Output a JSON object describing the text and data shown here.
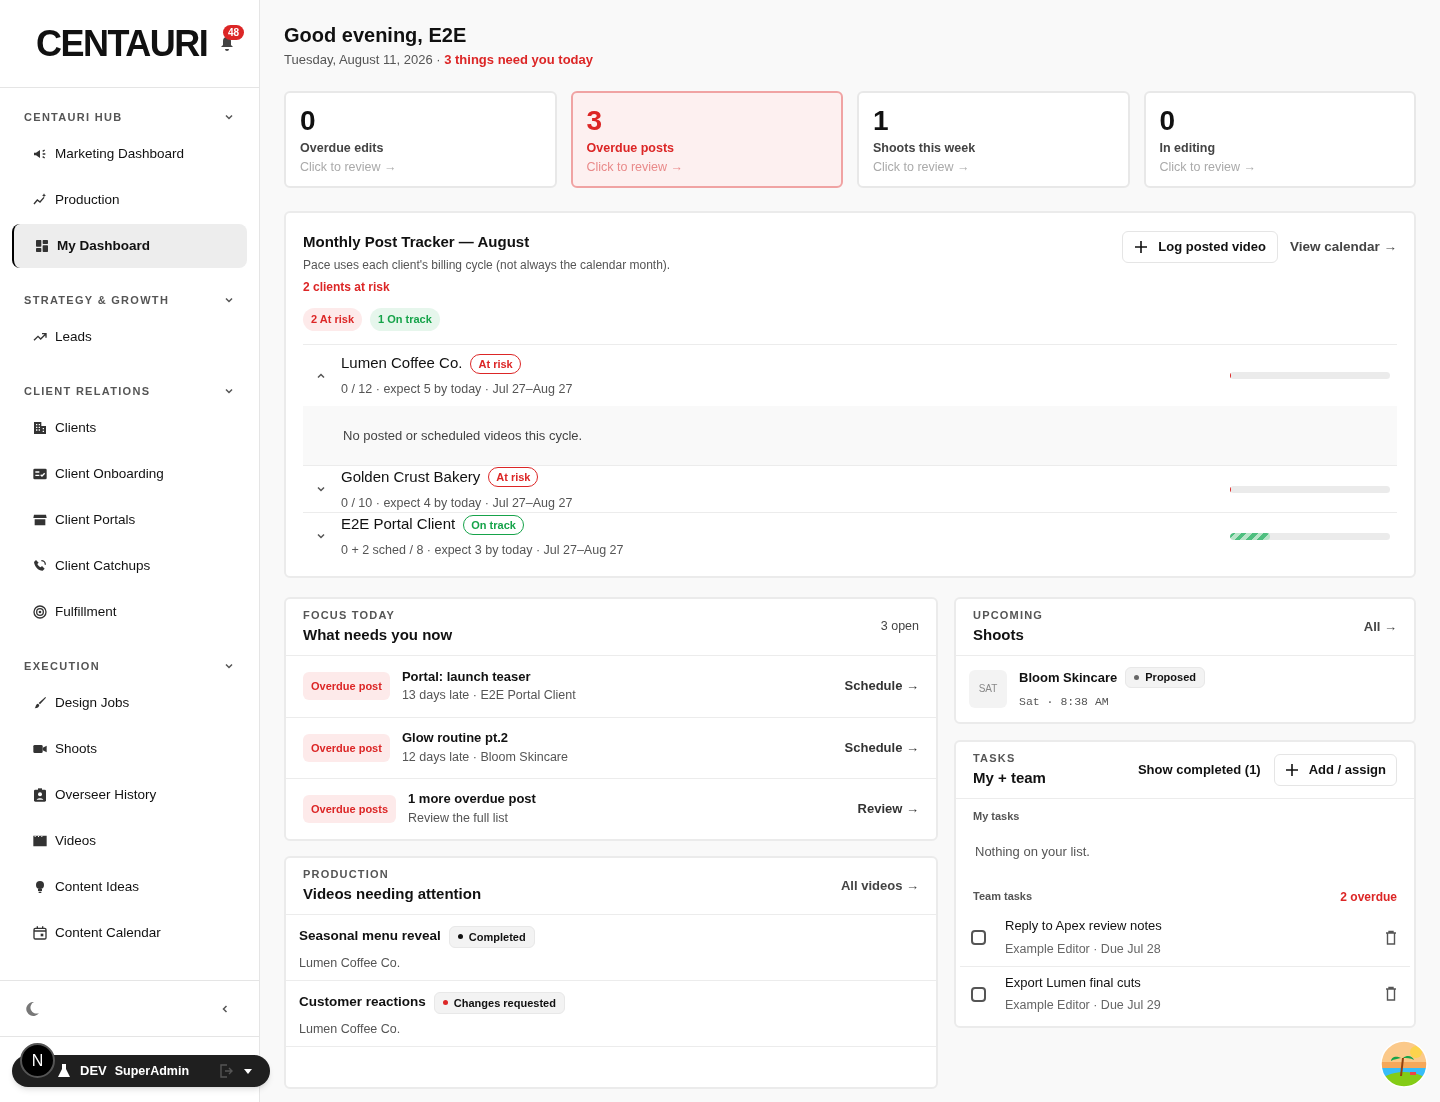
{
  "sidebar": {
    "logo": "CENTAURI",
    "notification_count": "48",
    "sections": [
      {
        "title": "CENTAURI HUB",
        "expanded": true,
        "items": [
          {
            "label": "Marketing Dashboard",
            "selected": false
          },
          {
            "label": "Production",
            "selected": false
          },
          {
            "label": "My Dashboard",
            "selected": true
          }
        ]
      },
      {
        "title": "STRATEGY & GROWTH",
        "expanded": true,
        "items": [
          {
            "label": "Leads",
            "selected": false
          }
        ]
      },
      {
        "title": "CLIENT RELATIONS",
        "expanded": true,
        "items": [
          {
            "label": "Clients",
            "selected": false
          },
          {
            "label": "Client Onboarding",
            "selected": false
          },
          {
            "label": "Client Portals",
            "selected": false
          },
          {
            "label": "Client Catchups",
            "selected": false
          },
          {
            "label": "Fulfillment",
            "selected": false
          }
        ]
      },
      {
        "title": "EXECUTION",
        "expanded": true,
        "items": [
          {
            "label": "Design Jobs",
            "selected": false
          },
          {
            "label": "Shoots",
            "selected": false
          },
          {
            "label": "Overseer History",
            "selected": false
          },
          {
            "label": "Videos",
            "selected": false
          },
          {
            "label": "Content Ideas",
            "selected": false
          },
          {
            "label": "Content Calendar",
            "selected": false
          }
        ]
      }
    ],
    "dev_toolbar": {
      "avatar": "N",
      "env": "DEV",
      "role": "SuperAdmin"
    }
  },
  "header": {
    "greeting": "Good evening, E2E",
    "date": "Tuesday, August 11, 2026 · ",
    "alert": "3 things need you today"
  },
  "stats": [
    {
      "value": "0",
      "label": "Overdue edits",
      "hint": "Click to review →",
      "highlighted": false
    },
    {
      "value": "3",
      "label": "Overdue posts",
      "hint": "Click to review →",
      "highlighted": true
    },
    {
      "value": "1",
      "label": "Shoots this week",
      "hint": "Click to review →",
      "highlighted": false
    },
    {
      "value": "0",
      "label": "In editing",
      "hint": "Click to review →",
      "highlighted": false
    }
  ],
  "tracker": {
    "title": "Monthly Post Tracker — August",
    "subtitle": "Pace uses each client's billing cycle (not always the calendar month).",
    "risk_summary": "2 clients at risk",
    "log_button": "Log posted video",
    "calendar_link": "View calendar →",
    "chips": [
      {
        "label": "2 At risk",
        "kind": "risk"
      },
      {
        "label": "1 On track",
        "kind": "ok"
      }
    ],
    "clients": [
      {
        "name": "Lumen Coffee Co.",
        "status": "At risk",
        "kind": "risk",
        "details": "0 / 12 · expect 5 by today · Jul 27–Aug 27",
        "expanded": true,
        "level": 0,
        "note": "No posted or scheduled videos this cycle."
      },
      {
        "name": "Golden Crust Bakery",
        "status": "At risk",
        "kind": "risk",
        "details": "0 / 10 · expect 4 by today · Jul 27–Aug 27",
        "expanded": false,
        "level": 0
      },
      {
        "name": "E2E Portal Client",
        "status": "On track",
        "kind": "ok",
        "details": "0 + 2 sched / 8 · expect 3 by today · Jul 27–Aug 27",
        "expanded": false,
        "level": 0.25
      }
    ]
  },
  "focus": {
    "eyebrow": "FOCUS TODAY",
    "title": "What needs you now",
    "count": "3 open",
    "items": [
      {
        "tag": "Overdue post",
        "title": "Portal: launch teaser",
        "subtitle": "13 days late · E2E Portal Client",
        "action": "Schedule →"
      },
      {
        "tag": "Overdue post",
        "title": "Glow routine pt.2",
        "subtitle": "12 days late · Bloom Skincare",
        "action": "Schedule →"
      },
      {
        "tag": "Overdue posts",
        "title": "1 more overdue post",
        "subtitle": "Review the full list",
        "action": "Review →"
      }
    ]
  },
  "production": {
    "eyebrow": "PRODUCTION",
    "title": "Videos needing attention",
    "link": "All videos →",
    "videos": [
      {
        "title": "Seasonal menu reveal",
        "status": "Completed",
        "color": "#111111",
        "client": "Lumen Coffee Co."
      },
      {
        "title": "Customer reactions",
        "status": "Changes requested",
        "color": "#dc2626",
        "client": "Lumen Coffee Co."
      }
    ]
  },
  "shoots": {
    "eyebrow": "UPCOMING",
    "title": "Shoots",
    "link": "All →",
    "items": [
      {
        "day": "SAT",
        "name": "Bloom Skincare",
        "status": "Proposed",
        "time": "Sat · 8:38 AM"
      }
    ]
  },
  "tasks": {
    "eyebrow": "TASKS",
    "title": "My + team",
    "show_completed": "Show completed (1)",
    "add_button": "Add / assign",
    "my_label": "My tasks",
    "my_empty": "Nothing on your list.",
    "team_label": "Team tasks",
    "team_overdue": "2 overdue",
    "items": [
      {
        "title": "Reply to Apex review notes",
        "meta": "Example Editor · Due Jul 28",
        "checked": false
      },
      {
        "title": "Export Lumen final cuts",
        "meta": "Example Editor · Due Jul 29",
        "checked": false
      }
    ]
  }
}
